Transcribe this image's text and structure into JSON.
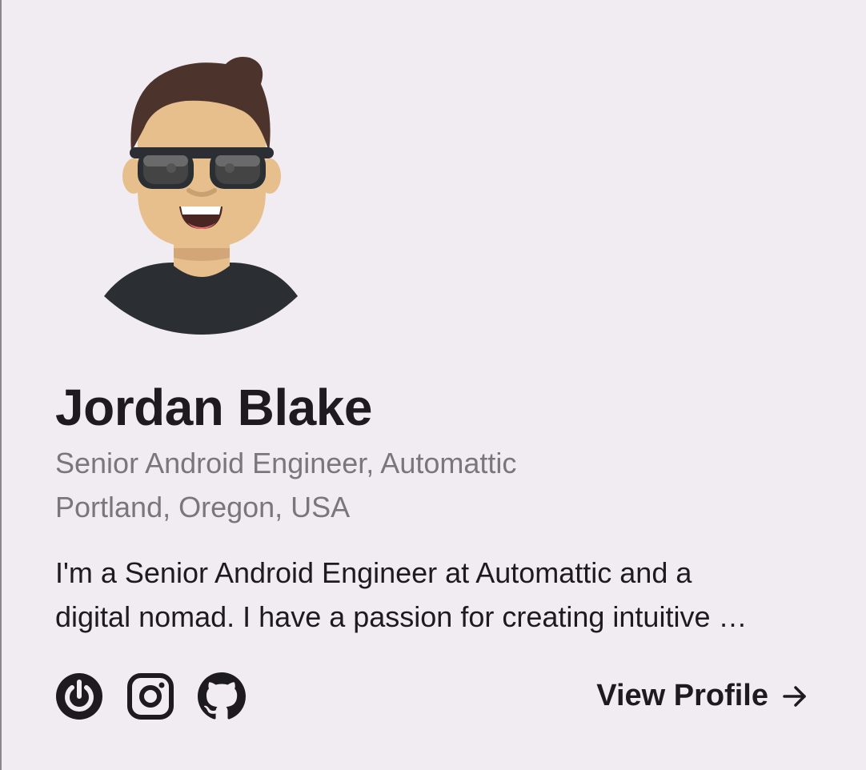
{
  "profile": {
    "name": "Jordan Blake",
    "job": "Senior Android Engineer, Automattic",
    "location": "Portland, Oregon, USA",
    "bio_line1": "I'm a Senior Android Engineer at Automattic and a",
    "bio_line2": "digital nomad. I have a passion for creating intuitive …"
  },
  "social": {
    "items": [
      {
        "name": "power-icon"
      },
      {
        "name": "instagram-icon"
      },
      {
        "name": "github-icon"
      }
    ]
  },
  "actions": {
    "view_profile_label": "View Profile",
    "arrow_icon": "arrow-right-icon"
  },
  "colors": {
    "background": "#f1ecf2",
    "text_primary": "#1d1b20",
    "text_secondary": "#79767d"
  }
}
